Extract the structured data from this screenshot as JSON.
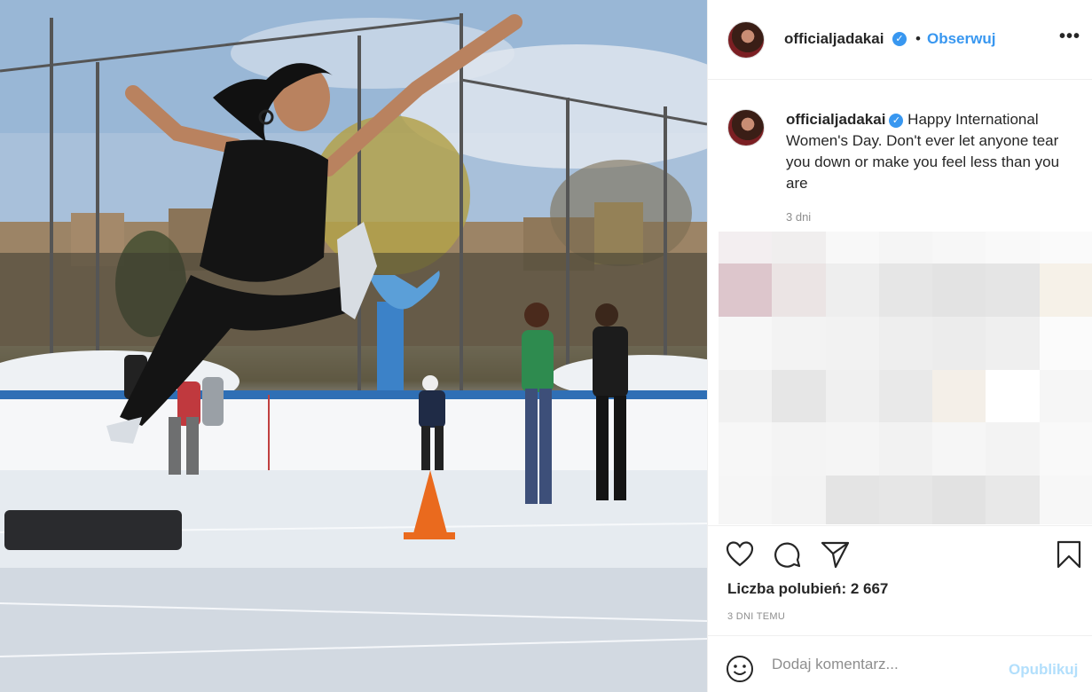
{
  "post": {
    "photo_alt": "",
    "author": {
      "handle": "officialjadakai",
      "verified_mark": "✓"
    },
    "header": {
      "separator": "•",
      "follow_label": "Obserwuj",
      "more_label": "•••"
    },
    "caption": {
      "handle": "officialjadakai",
      "text": "Happy International Women's Day. Don't ever let anyone tear you down or make you feel less than you are",
      "time": "3 dni"
    },
    "actions": {
      "like_icon": "heart-icon",
      "comment_icon": "comment-icon",
      "share_icon": "share-icon",
      "save_icon": "bookmark-icon"
    },
    "likes_text": "Liczba polubień: 2 667",
    "date_text": "3 DNI TEMU",
    "comment": {
      "emoji_icon": "emoji-icon",
      "placeholder": "Dodaj komentarz...",
      "publish_label": "Opublikuj"
    },
    "colors": {
      "accent": "#3897f0",
      "publish_disabled": "#b2dffc",
      "muted": "#8e8e8e"
    }
  }
}
